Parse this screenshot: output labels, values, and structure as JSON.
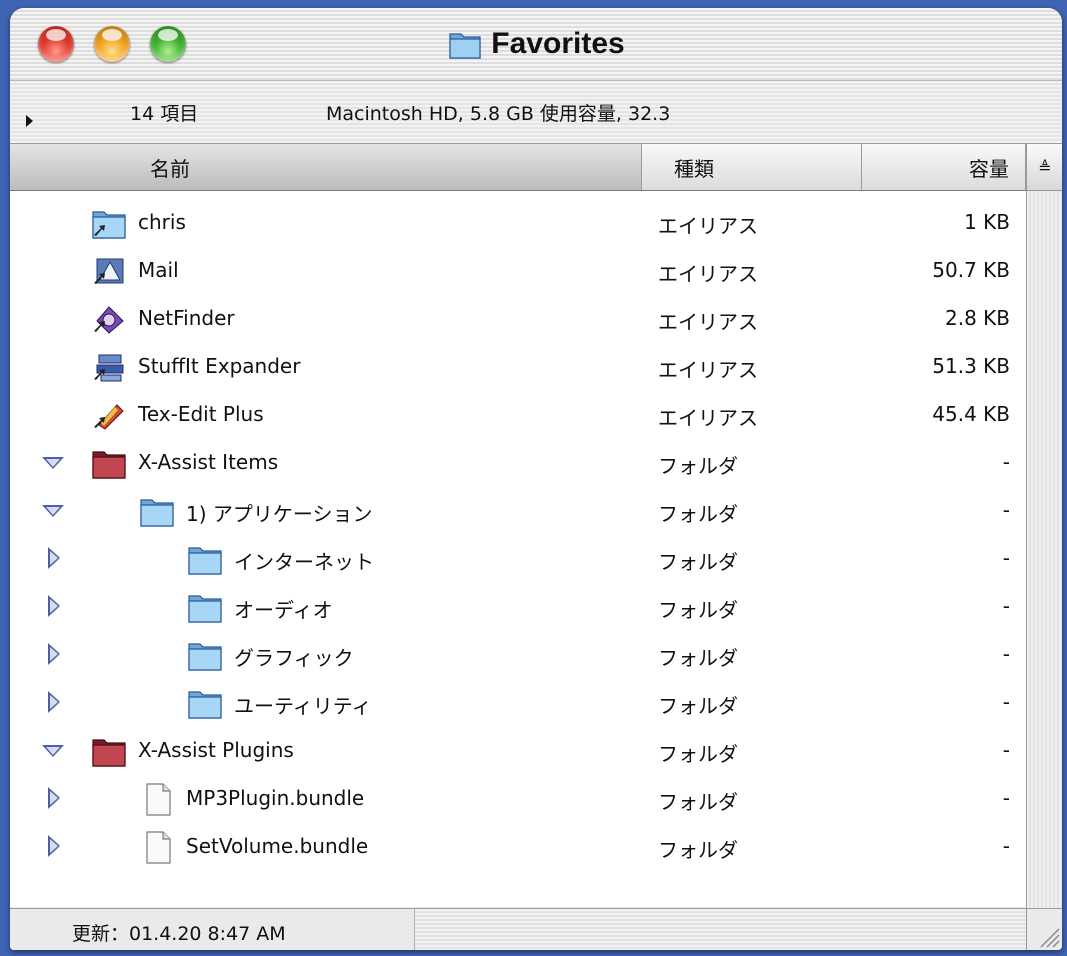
{
  "window": {
    "title": "Favorites"
  },
  "info": {
    "item_count": "14 項目",
    "disk_info": "Macintosh HD, 5.8 GB 使用容量, 32.3"
  },
  "columns": {
    "name": "名前",
    "kind": "種類",
    "size": "容量"
  },
  "rows": [
    {
      "name": "chris",
      "kind": "エイリアス",
      "size": "1 KB",
      "icon": "folder-alias-icon",
      "indent": 0,
      "disclosure": "none"
    },
    {
      "name": "Mail",
      "kind": "エイリアス",
      "size": "50.7 KB",
      "icon": "mail-app-alias-icon",
      "indent": 0,
      "disclosure": "none"
    },
    {
      "name": "NetFinder",
      "kind": "エイリアス",
      "size": "2.8 KB",
      "icon": "netfinder-app-alias-icon",
      "indent": 0,
      "disclosure": "none"
    },
    {
      "name": "StuffIt Expander",
      "kind": "エイリアス",
      "size": "51.3 KB",
      "icon": "stuffit-app-alias-icon",
      "indent": 0,
      "disclosure": "none"
    },
    {
      "name": "Tex-Edit Plus",
      "kind": "エイリアス",
      "size": "45.4 KB",
      "icon": "texedit-app-alias-icon",
      "indent": 0,
      "disclosure": "none"
    },
    {
      "name": "X-Assist Items",
      "kind": "フォルダ",
      "size": "-",
      "icon": "red-folder-icon",
      "indent": 0,
      "disclosure": "open"
    },
    {
      "name": "1) アプリケーション",
      "kind": "フォルダ",
      "size": "-",
      "icon": "folder-icon",
      "indent": 1,
      "disclosure": "open"
    },
    {
      "name": "インターネット",
      "kind": "フォルダ",
      "size": "-",
      "icon": "folder-icon",
      "indent": 2,
      "disclosure": "closed"
    },
    {
      "name": "オーディオ",
      "kind": "フォルダ",
      "size": "-",
      "icon": "folder-icon",
      "indent": 2,
      "disclosure": "closed"
    },
    {
      "name": "グラフィック",
      "kind": "フォルダ",
      "size": "-",
      "icon": "folder-icon",
      "indent": 2,
      "disclosure": "closed"
    },
    {
      "name": "ユーティリティ",
      "kind": "フォルダ",
      "size": "-",
      "icon": "folder-icon",
      "indent": 2,
      "disclosure": "closed"
    },
    {
      "name": "X-Assist Plugins",
      "kind": "フォルダ",
      "size": "-",
      "icon": "red-folder-icon",
      "indent": 0,
      "disclosure": "open"
    },
    {
      "name": "MP3Plugin.bundle",
      "kind": "フォルダ",
      "size": "-",
      "icon": "document-icon",
      "indent": 1,
      "disclosure": "closed"
    },
    {
      "name": "SetVolume.bundle",
      "kind": "フォルダ",
      "size": "-",
      "icon": "document-icon",
      "indent": 1,
      "disclosure": "closed"
    }
  ],
  "status": {
    "modified": "更新：01.4.20 8:47 AM"
  },
  "colors": {
    "desktop": "#3f64b4",
    "disclosure": "#4d5fa6",
    "folder_blue": "#8ec4ee",
    "folder_red": "#b0343c"
  }
}
